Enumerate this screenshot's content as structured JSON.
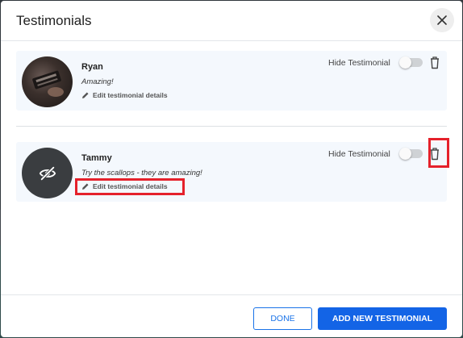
{
  "modal": {
    "title": "Testimonials"
  },
  "testimonials": [
    {
      "name": "Ryan",
      "quote": "Amazing!",
      "edit_label": "Edit testimonial details",
      "hide_label": "Hide Testimonial",
      "hidden": false,
      "avatar": "photo"
    },
    {
      "name": "Tammy",
      "quote": "Try the scallops - they are amazing!",
      "edit_label": "Edit testimonial details",
      "hide_label": "Hide Testimonial",
      "hidden": false,
      "avatar": "eye-slash-icon"
    }
  ],
  "footer": {
    "done_label": "DONE",
    "add_label": "ADD NEW TESTIMONIAL"
  },
  "colors": {
    "primary": "#1364e6",
    "highlight": "#e5212b",
    "card_bg": "#f4f8fd"
  }
}
